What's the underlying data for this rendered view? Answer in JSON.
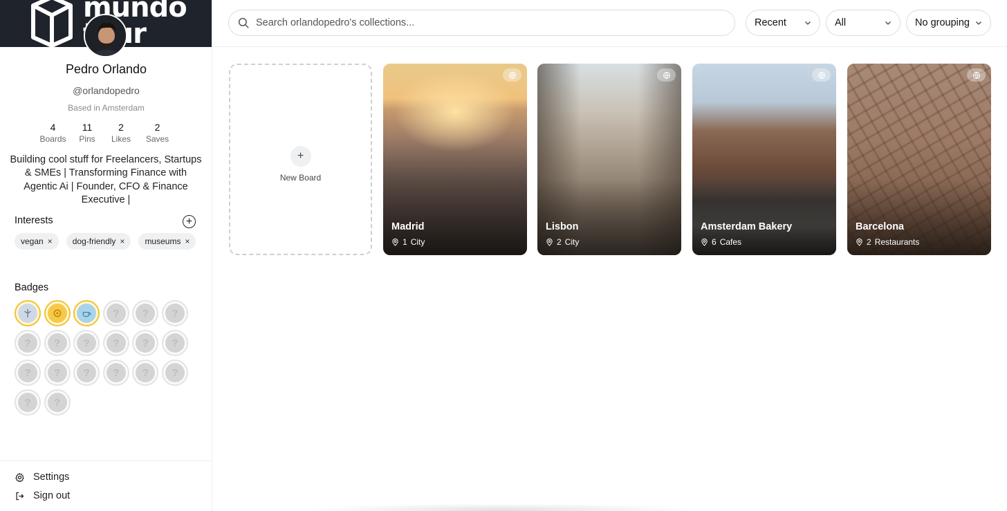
{
  "brand": {
    "logo_text": "mundo tour"
  },
  "profile": {
    "name": "Pedro Orlando",
    "handle": "@orlandopedro",
    "location": "Based in Amsterdam",
    "stats": [
      {
        "value": "4",
        "label": "Boards"
      },
      {
        "value": "11",
        "label": "Pins"
      },
      {
        "value": "2",
        "label": "Likes"
      },
      {
        "value": "2",
        "label": "Saves"
      }
    ],
    "bio": "Building cool stuff for Freelancers, Startups & SMEs | Transforming Finance with Agentic Ai | Founder, CFO & Finance Executive |"
  },
  "interests": {
    "title": "Interests",
    "add_icon": "plus-circle-icon",
    "items": [
      {
        "label": "vegan",
        "remove": "×"
      },
      {
        "label": "dog-friendly",
        "remove": "×"
      },
      {
        "label": "museums",
        "remove": "×"
      }
    ]
  },
  "badges": {
    "title": "Badges",
    "total": 20,
    "earned": 3,
    "locked_symbol": "?"
  },
  "sidebar_footer": {
    "settings_label": "Settings",
    "signout_label": "Sign out"
  },
  "search": {
    "placeholder": "Search orlandopedro's collections..."
  },
  "filters": {
    "sort": "Recent",
    "type": "All",
    "grouping": "No grouping"
  },
  "new_board": {
    "label": "New Board",
    "icon": "+"
  },
  "boards": [
    {
      "title": "Madrid",
      "count": "1",
      "category": "City"
    },
    {
      "title": "Lisbon",
      "count": "2",
      "category": "City"
    },
    {
      "title": "Amsterdam Bakery",
      "count": "6",
      "category": "Cafes"
    },
    {
      "title": "Barcelona",
      "count": "2",
      "category": "Restaurants"
    }
  ],
  "colors": {
    "banner": "#1f232b",
    "badge_earned_ring": "#f2c230",
    "chip_bg": "#eef0f2"
  }
}
